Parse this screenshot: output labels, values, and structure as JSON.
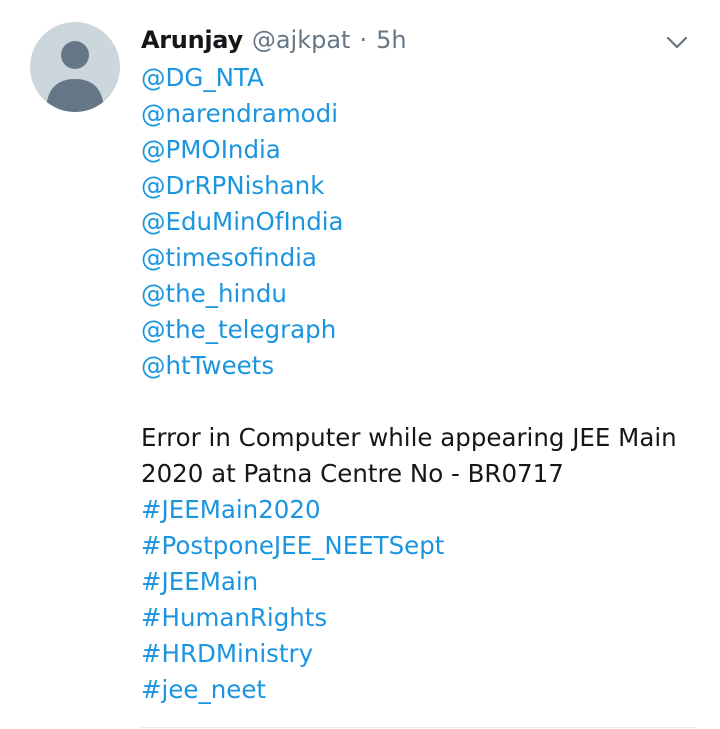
{
  "author": {
    "display_name": "Arunjay",
    "handle": "@ajkpat",
    "separator": "·",
    "time": "5h"
  },
  "icons": {
    "avatar": "default-profile-avatar-icon",
    "menu": "chevron-down-icon"
  },
  "colors": {
    "link": "#1b95e0",
    "text": "#14171a",
    "muted": "#657786",
    "avatar_bg": "#ccd6dd",
    "avatar_fg": "#657786"
  },
  "mentions": [
    "@DG_NTA",
    "@narendramodi",
    "@PMOIndia",
    "@DrRPNishank",
    "@EduMinOfIndia",
    "@timesofindia",
    "@the_hindu",
    "@the_telegraph",
    "@htTweets"
  ],
  "message": [
    "Error in Computer while appearing JEE Main",
    "2020 at Patna Centre No - BR0717"
  ],
  "hashtags": [
    "#JEEMain2020",
    "#PostponeJEE_NEETSept",
    "#JEEMain",
    "#HumanRights",
    "#HRDMinistry",
    "#jee_neet"
  ]
}
